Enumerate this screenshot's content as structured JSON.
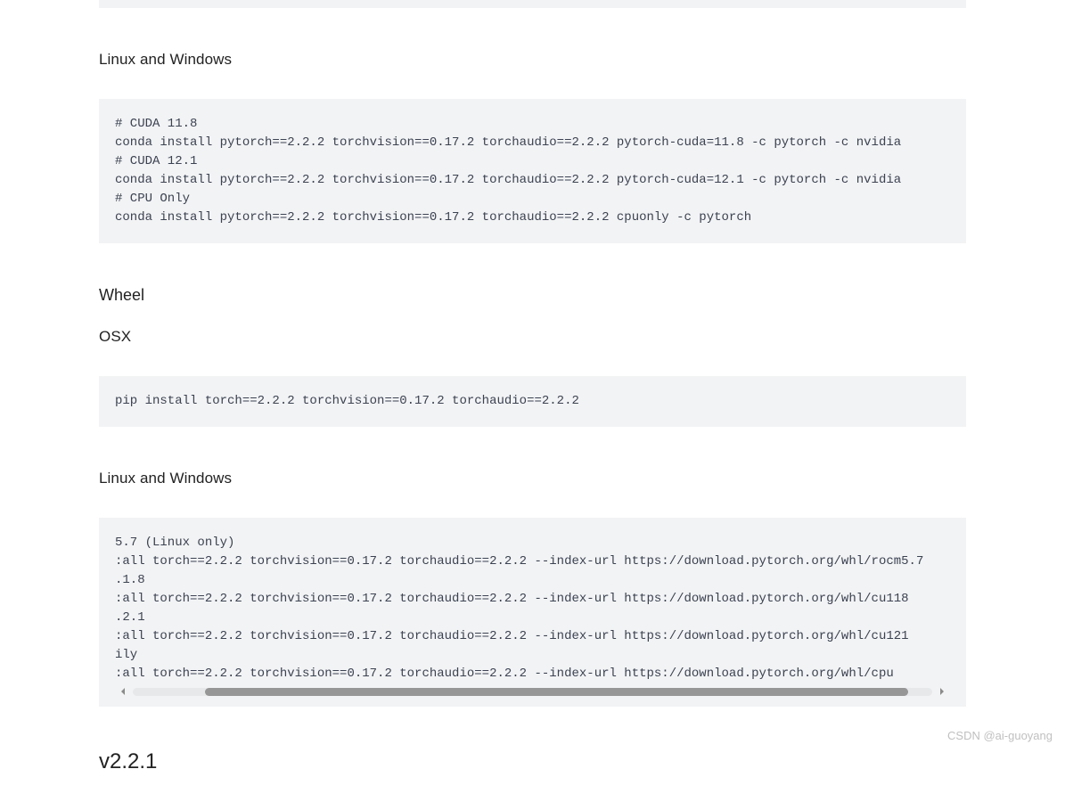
{
  "sections": {
    "s1": {
      "heading": "Linux and Windows",
      "code": "# CUDA 11.8\nconda install pytorch==2.2.2 torchvision==0.17.2 torchaudio==2.2.2 pytorch-cuda=11.8 -c pytorch -c nvidia\n# CUDA 12.1\nconda install pytorch==2.2.2 torchvision==0.17.2 torchaudio==2.2.2 pytorch-cuda=12.1 -c pytorch -c nvidia\n# CPU Only\nconda install pytorch==2.2.2 torchvision==0.17.2 torchaudio==2.2.2 cpuonly -c pytorch"
    },
    "s2": {
      "heading": "Wheel"
    },
    "s3": {
      "heading": "OSX",
      "code": "pip install torch==2.2.2 torchvision==0.17.2 torchaudio==2.2.2"
    },
    "s4": {
      "heading": "Linux and Windows",
      "code": "5.7 (Linux only)\n:all torch==2.2.2 torchvision==0.17.2 torchaudio==2.2.2 --index-url https://download.pytorch.org/whl/rocm5.7\n.1.8\n:all torch==2.2.2 torchvision==0.17.2 torchaudio==2.2.2 --index-url https://download.pytorch.org/whl/cu118\n.2.1\n:all torch==2.2.2 torchvision==0.17.2 torchaudio==2.2.2 --index-url https://download.pytorch.org/whl/cu121\nily\n:all torch==2.2.2 torchvision==0.17.2 torchaudio==2.2.2 --index-url https://download.pytorch.org/whl/cpu"
    },
    "version": "v2.2.1"
  },
  "watermark": "CSDN @ai-guoyang"
}
